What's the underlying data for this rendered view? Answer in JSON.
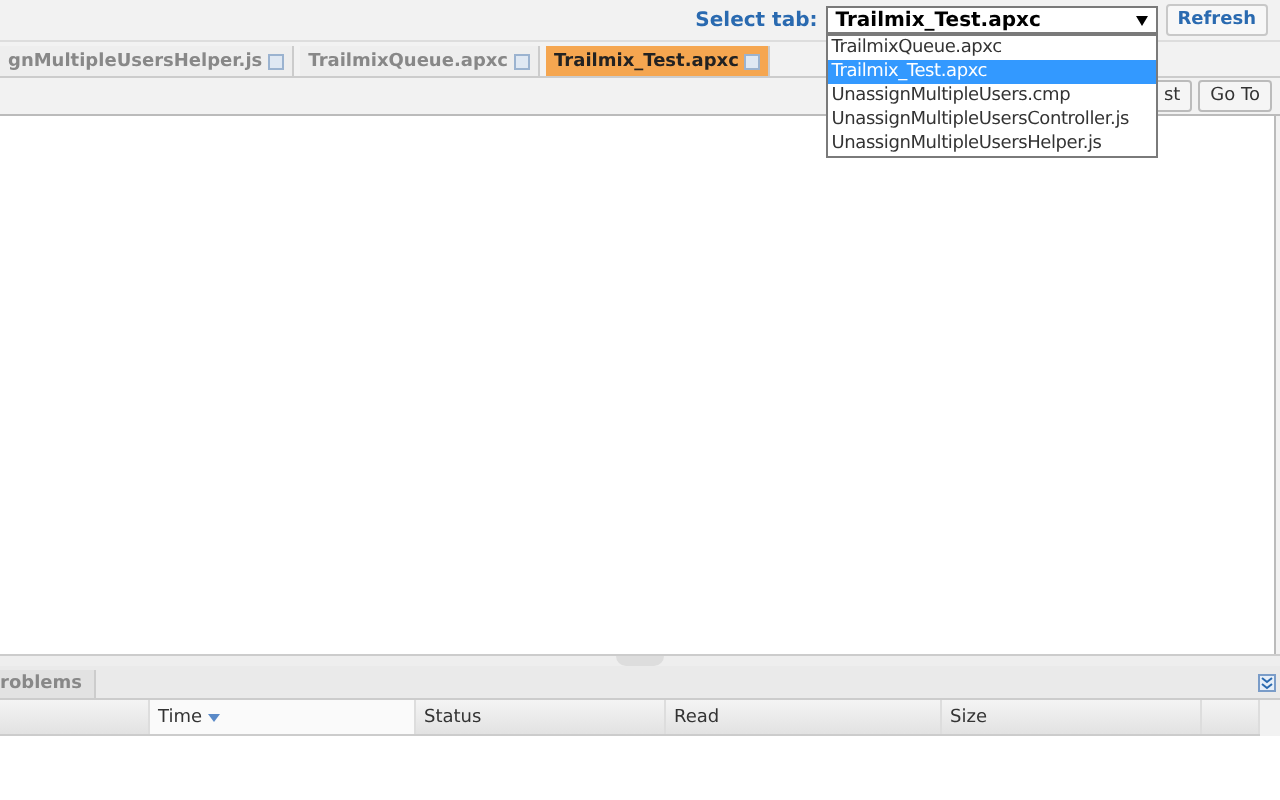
{
  "top_bar": {
    "label": "Select tab:",
    "select": {
      "value": "Trailmix_Test.apxc",
      "expanded": true,
      "options": [
        {
          "label": "TrailmixQueue.apxc",
          "selected": false
        },
        {
          "label": "Trailmix_Test.apxc",
          "selected": true
        },
        {
          "label": "UnassignMultipleUsers.cmp",
          "selected": false
        },
        {
          "label": "UnassignMultipleUsersController.js",
          "selected": false
        },
        {
          "label": "UnassignMultipleUsersHelper.js",
          "selected": false
        }
      ]
    },
    "refresh": "Refresh"
  },
  "tabs": [
    {
      "label": "gnMultipleUsersHelper.js",
      "selected": false
    },
    {
      "label": "TrailmixQueue.apxc",
      "selected": false
    },
    {
      "label": "Trailmix_Test.apxc",
      "selected": true
    }
  ],
  "toolbar": {
    "buttons": [
      "st",
      "Go To"
    ]
  },
  "bottom_panel": {
    "tab": "roblems",
    "columns": [
      "",
      "Time",
      "Status",
      "Read",
      "Size"
    ]
  }
}
